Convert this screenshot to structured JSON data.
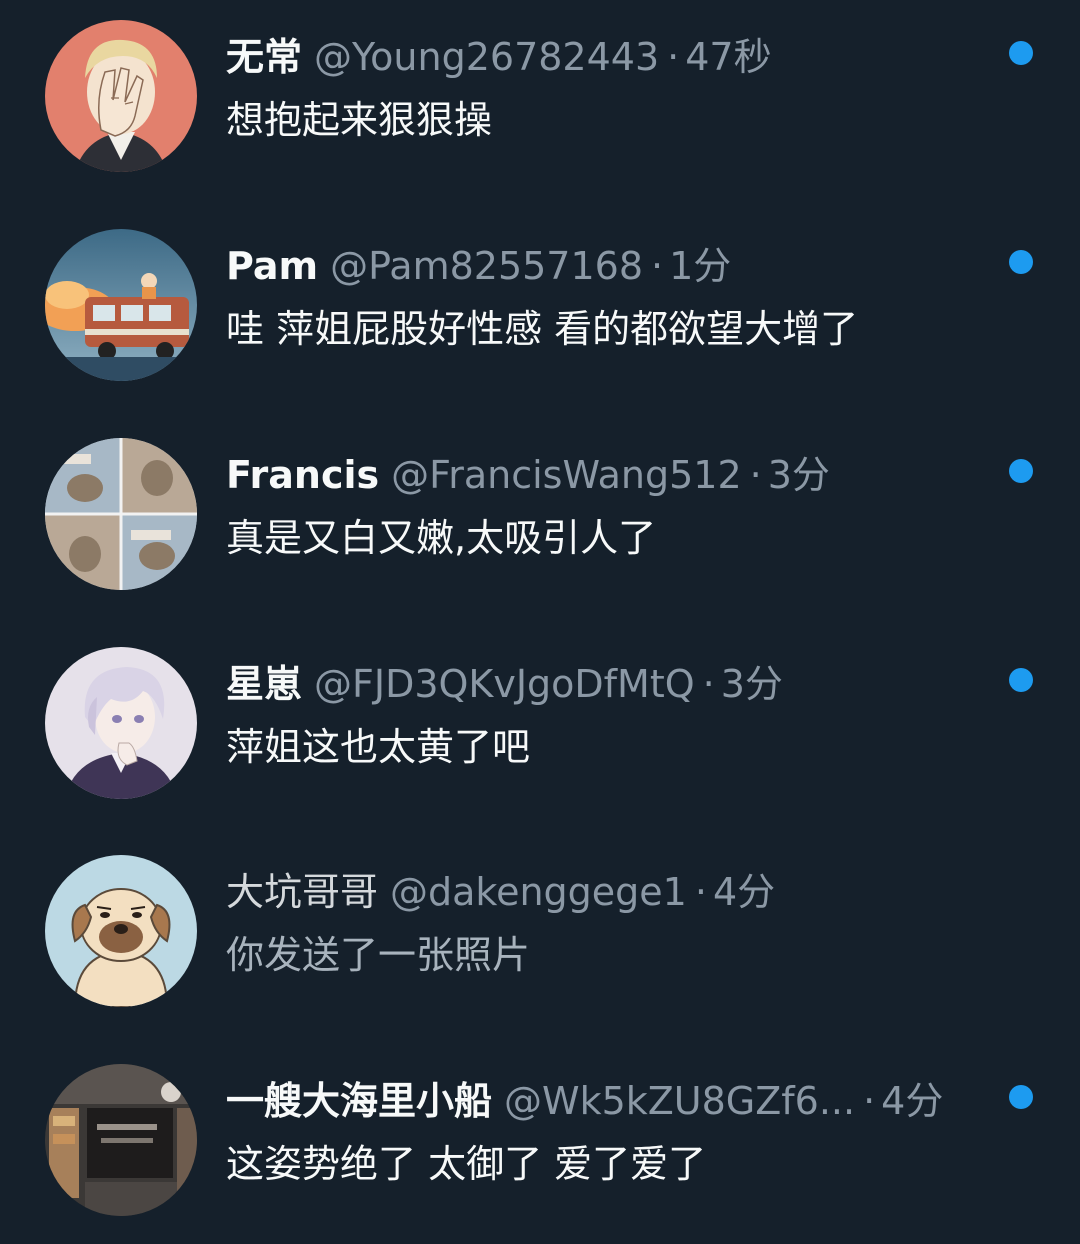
{
  "conversations": [
    {
      "display_name": "无常",
      "handle": "@Young26782443",
      "separator": "·",
      "time": "47秒",
      "preview": "想抱起来狠狠操",
      "unread": true,
      "avatar_icon": "facepalm-anime-man-avatar"
    },
    {
      "display_name": "Pam",
      "handle": "@Pam82557168",
      "separator": "·",
      "time": "1分",
      "preview": "哇 萍姐屁股好性感 看的都欲望大增了",
      "unread": true,
      "avatar_icon": "sunset-bus-avatar"
    },
    {
      "display_name": "Francis",
      "handle": "@FrancisWang512",
      "separator": "·",
      "time": "3分",
      "preview": "真是又白又嫩,太吸引人了",
      "unread": true,
      "avatar_icon": "cat-grid-avatar"
    },
    {
      "display_name": "星崽",
      "handle": "@FJD3QKvJgoDfMtQ",
      "separator": "·",
      "time": "3分",
      "preview": "萍姐这也太黄了吧",
      "unread": true,
      "avatar_icon": "anime-boy-avatar"
    },
    {
      "display_name": "大坑哥哥",
      "handle": "@dakenggege1",
      "separator": "·",
      "time": "4分",
      "preview": "你发送了一张照片",
      "unread": false,
      "avatar_icon": "cartoon-dog-avatar"
    },
    {
      "display_name": "一艘大海里小船",
      "handle": "@Wk5kZU8GZf6...",
      "separator": "·",
      "time": "4分",
      "preview": "这姿势绝了 太御了 爱了爱了",
      "unread": true,
      "avatar_icon": "dark-storefront-avatar"
    }
  ],
  "colors": {
    "background": "#15202b",
    "unread_dot": "#1d9bf0",
    "secondary_text": "#8b98a5",
    "primary_text": "#f7f9f9"
  }
}
